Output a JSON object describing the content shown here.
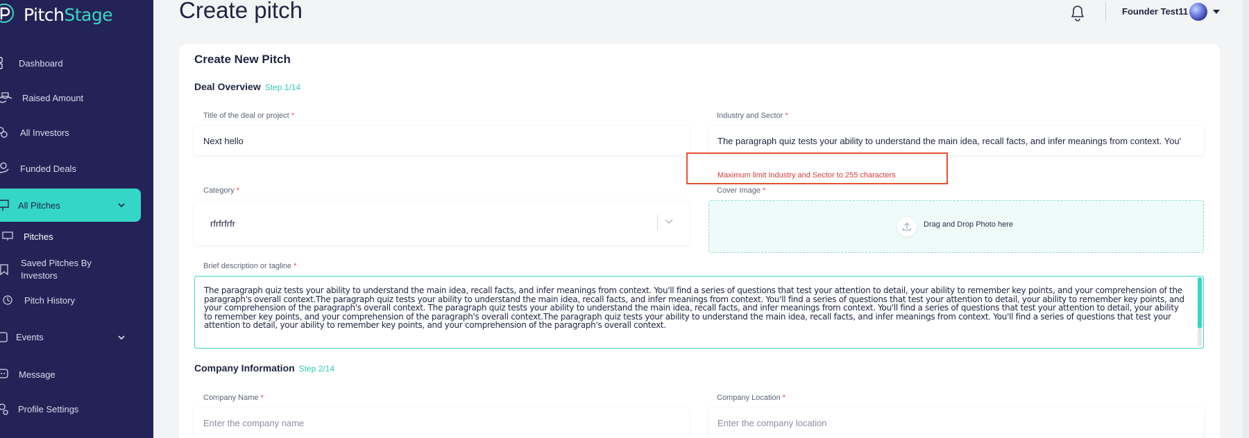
{
  "app": {
    "brand_part1": "Pitch",
    "brand_part2": "Stage"
  },
  "sidebar": {
    "items": [
      {
        "label": "Dashboard"
      },
      {
        "label": "Raised Amount"
      },
      {
        "label": "All Investors"
      },
      {
        "label": "Funded Deals"
      },
      {
        "label": "All Pitches"
      },
      {
        "label": "Events"
      },
      {
        "label": "Message"
      },
      {
        "label": "Profile Settings"
      }
    ],
    "sub_items": [
      {
        "label": "Pitches"
      },
      {
        "label": "Saved Pitches By Investors"
      },
      {
        "label": "Pitch History"
      }
    ]
  },
  "header": {
    "title": "Create pitch",
    "user_name": "Founder Test11"
  },
  "form": {
    "title": "Create New Pitch",
    "sections": [
      {
        "title": "Deal Overview",
        "step": "Step 1/14"
      },
      {
        "title": "Company Information",
        "step": "Step 2/14"
      }
    ],
    "required_mark": "*",
    "deal_title": {
      "label": "Title of the deal or project",
      "value": "Next hello"
    },
    "industry": {
      "label": "Industry and Sector",
      "value": "The paragraph quiz tests your ability to understand the main idea, recall facts, and infer meanings from context. You'",
      "error": "Maximum limit Industry and Sector to 255 characters"
    },
    "category": {
      "label": "Category",
      "value": "rfrfrfrfr"
    },
    "cover_image": {
      "label": "Cover Image",
      "dropzone_text": "Drag and Drop Photo here"
    },
    "description": {
      "label": "Brief description or tagline",
      "value": "The paragraph quiz tests your ability to understand the main idea, recall facts, and infer meanings from context. You'll find a series of questions that test your attention to detail, your ability to remember key points, and your comprehension of the paragraph's overall context.The paragraph quiz tests your ability to understand the main idea, recall facts, and infer meanings from context. You'll find a series of questions that test your attention to detail, your ability to remember key points, and your comprehension of the paragraph's overall context.   The paragraph quiz tests your ability to understand the main idea, recall facts, and infer meanings from context. You'll find a series of questions that test your attention to detail, your ability to remember key points, and your comprehension of the paragraph's overall context.The paragraph quiz tests your ability to understand the main idea, recall facts, and infer meanings from context. You'll find a series of questions that test your attention to detail, your ability to remember key points, and your comprehension of the paragraph's overall context."
    },
    "company_name": {
      "label": "Company Name",
      "placeholder": "Enter the company name"
    },
    "company_location": {
      "label": "Company Location",
      "placeholder": "Enter the company location"
    }
  },
  "colors": {
    "sidebar_bg": "#242357",
    "accent": "#34d7c6",
    "error": "#d83a3a",
    "highlight_box": "#e5502f"
  },
  "icons": {
    "sidebar": [
      "dashboard-icon",
      "money-icon",
      "investors-icon",
      "funded-icon",
      "presentation-icon",
      "calendar-icon",
      "chat-icon",
      "settings-icon"
    ],
    "sub": [
      "monitor-icon",
      "bookmark-icon",
      "history-icon"
    ]
  }
}
